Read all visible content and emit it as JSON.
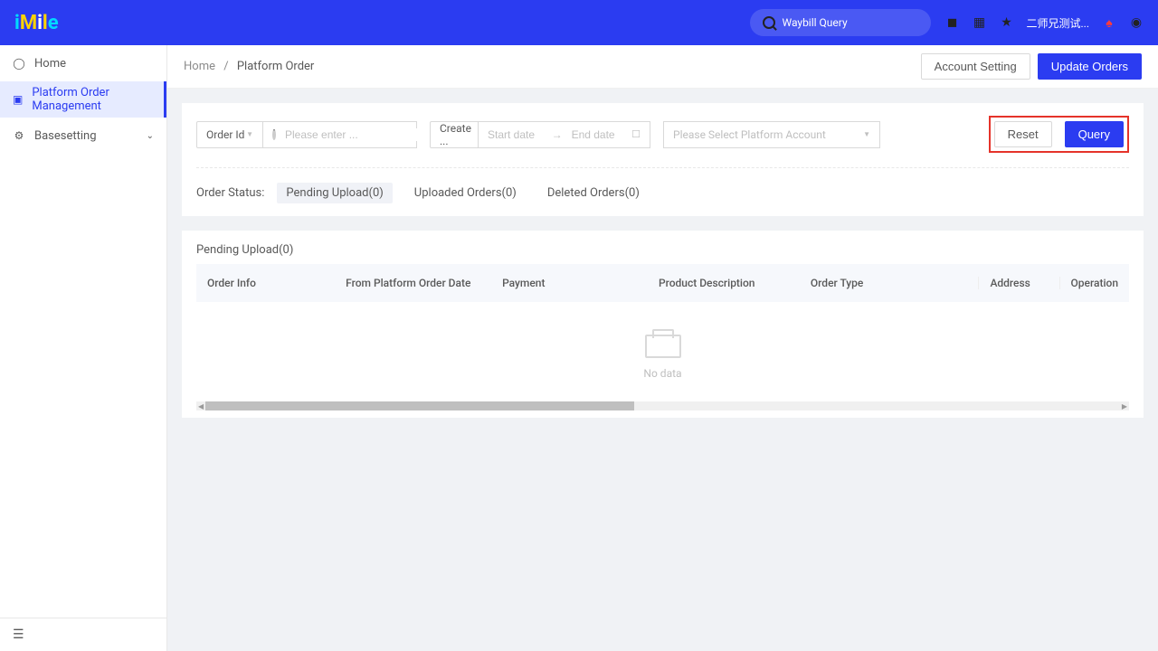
{
  "header": {
    "search_placeholder": "Waybill Query",
    "username": "二师兄测试..."
  },
  "sidebar": {
    "items": [
      {
        "label": "Home"
      },
      {
        "label": "Platform Order Management"
      },
      {
        "label": "Basesetting"
      }
    ]
  },
  "breadcrumb": {
    "home": "Home",
    "sep": "/",
    "current": "Platform Order"
  },
  "topbar": {
    "account_setting": "Account Setting",
    "update_orders": "Update Orders"
  },
  "filters": {
    "orderid_label": "Order Id",
    "orderid_placeholder": "Please enter ...",
    "create_label": "Create ...",
    "start_date_placeholder": "Start date",
    "end_date_placeholder": "End date",
    "platform_placeholder": "Please Select Platform Account",
    "reset": "Reset",
    "query": "Query"
  },
  "status": {
    "label": "Order Status:",
    "pending": "Pending Upload(0)",
    "uploaded": "Uploaded Orders(0)",
    "deleted": "Deleted Orders(0)"
  },
  "table": {
    "title": "Pending Upload(0)",
    "cols": {
      "c1": "Order Info",
      "c2": "From Platform Order Date",
      "c3": "Payment",
      "c4": "Product Description",
      "c5": "Order Type",
      "c6": "Address",
      "c7": "Operation"
    },
    "empty": "No data"
  }
}
